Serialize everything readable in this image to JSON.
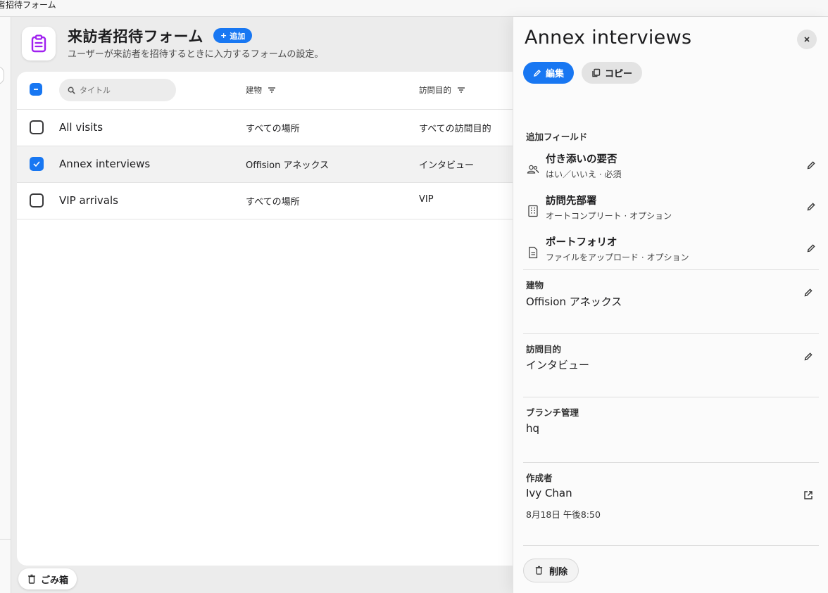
{
  "window": {
    "title": "者招待フォーム"
  },
  "header": {
    "title": "来訪者招待フォーム",
    "add_label": "追加",
    "subtitle": "ユーザーが来訪者を招待するときに入力するフォームの設定。"
  },
  "table": {
    "search_placeholder": "タイトル",
    "columns": [
      "建物",
      "訪問目的"
    ],
    "rows": [
      {
        "title": "All visits",
        "building": "すべての場所",
        "purpose": "すべての訪問目的",
        "checked": false
      },
      {
        "title": "Annex interviews",
        "building": "Offision アネックス",
        "purpose": "インタビュー",
        "checked": true
      },
      {
        "title": "VIP arrivals",
        "building": "すべての場所",
        "purpose": "VIP",
        "checked": false
      }
    ]
  },
  "trash": {
    "label": "ごみ箱"
  },
  "panel": {
    "title": "Annex interviews",
    "edit_label": "編集",
    "copy_label": "コピー",
    "extra_fields_label": "追加フィールド",
    "fields": [
      {
        "name": "付き添いの要否",
        "meta": "はい／いいえ · 必須",
        "icon": "people-icon"
      },
      {
        "name": "訪問先部署",
        "meta": "オートコンプリート · オプション",
        "icon": "building-icon"
      },
      {
        "name": "ポートフォリオ",
        "meta": "ファイルをアップロード · オプション",
        "icon": "document-icon"
      }
    ],
    "building_label": "建物",
    "building_value": "Offision アネックス",
    "purpose_label": "訪問目的",
    "purpose_value": "インタビュー",
    "branch_label": "ブランチ管理",
    "branch_value": "hq",
    "author_label": "作成者",
    "author_value": "Ivy Chan",
    "author_date": "8月18日 午後8:50",
    "delete_label": "削除"
  },
  "colors": {
    "accent": "#1877f2",
    "icon_purple": "#a020f0"
  }
}
